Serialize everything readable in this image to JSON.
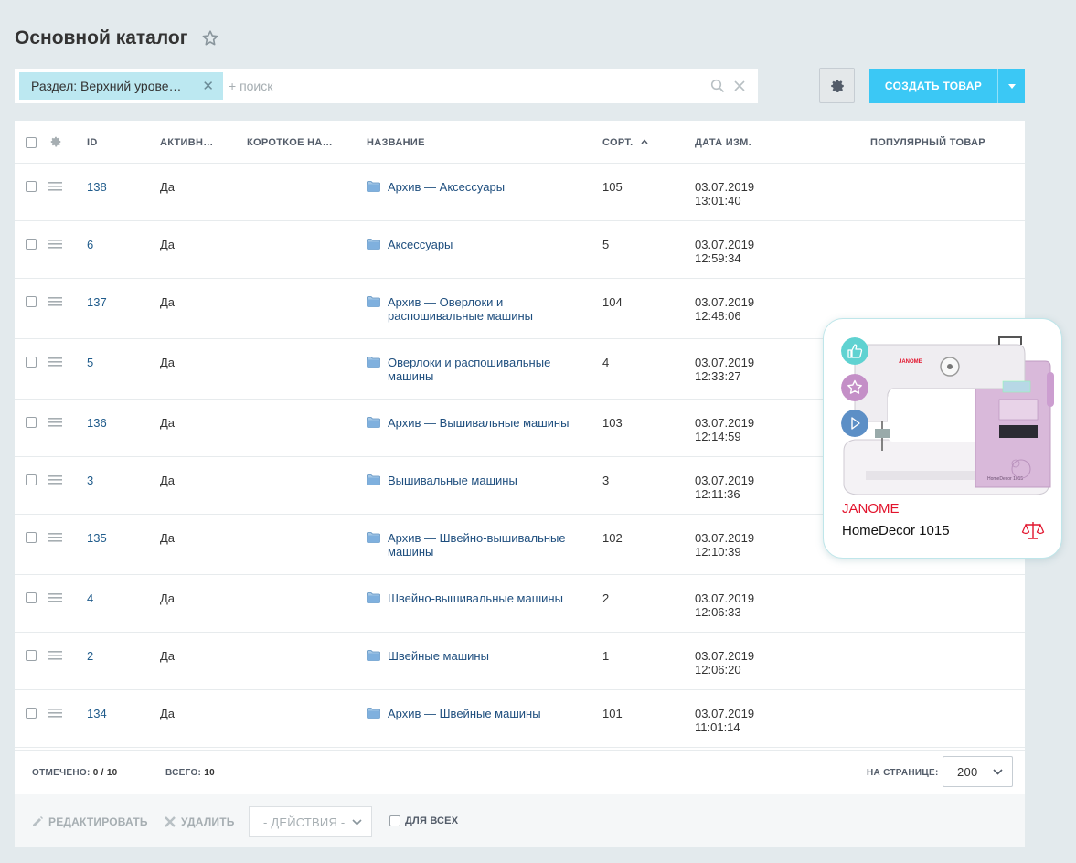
{
  "page": {
    "title": "Основной каталог"
  },
  "filter": {
    "tag_label": "Раздел: Верхний урове…",
    "search_placeholder": "+ поиск"
  },
  "toolbar": {
    "create_label": "СОЗДАТЬ ТОВАР"
  },
  "columns": {
    "id": "ID",
    "active": "АКТИВН…",
    "short_name": "КОРОТКОЕ НА…",
    "name": "НАЗВАНИЕ",
    "sort": "СОРТ.",
    "date": "ДАТА ИЗМ.",
    "popular": "ПОПУЛЯРНЫЙ ТОВАР"
  },
  "rows": [
    {
      "id": "138",
      "active": "Да",
      "name": "Архив — Аксессуары",
      "sort": "105",
      "date": "03.07.2019",
      "time": "13:01:40"
    },
    {
      "id": "6",
      "active": "Да",
      "name": "Аксессуары",
      "sort": "5",
      "date": "03.07.2019",
      "time": "12:59:34"
    },
    {
      "id": "137",
      "active": "Да",
      "name": "Архив — Оверлоки и распошивальные машины",
      "sort": "104",
      "date": "03.07.2019",
      "time": "12:48:06"
    },
    {
      "id": "5",
      "active": "Да",
      "name": "Оверлоки и распошивальные машины",
      "sort": "4",
      "date": "03.07.2019",
      "time": "12:33:27"
    },
    {
      "id": "136",
      "active": "Да",
      "name": "Архив — Вышивальные машины",
      "sort": "103",
      "date": "03.07.2019",
      "time": "12:14:59"
    },
    {
      "id": "3",
      "active": "Да",
      "name": "Вышивальные машины",
      "sort": "3",
      "date": "03.07.2019",
      "time": "12:11:36"
    },
    {
      "id": "135",
      "active": "Да",
      "name": "Архив — Швейно-вышивальные машины",
      "sort": "102",
      "date": "03.07.2019",
      "time": "12:10:39"
    },
    {
      "id": "4",
      "active": "Да",
      "name": "Швейно-вышивальные машины",
      "sort": "2",
      "date": "03.07.2019",
      "time": "12:06:33"
    },
    {
      "id": "2",
      "active": "Да",
      "name": "Швейные машины",
      "sort": "1",
      "date": "03.07.2019",
      "time": "12:06:20"
    },
    {
      "id": "134",
      "active": "Да",
      "name": "Архив — Швейные машины",
      "sort": "101",
      "date": "03.07.2019",
      "time": "11:01:14"
    }
  ],
  "footer": {
    "selected_label": "ОТМЕЧЕНО:",
    "selected_value": "0 / 10",
    "total_label": "ВСЕГО:",
    "total_value": "10",
    "per_page_label": "НА СТРАНИЦЕ:",
    "per_page_value": "200"
  },
  "actions": {
    "edit_label": "РЕДАКТИРОВАТЬ",
    "delete_label": "УДАЛИТЬ",
    "actions_select": "- ДЕЙСТВИЯ -",
    "for_all_label": "ДЛЯ ВСЕХ"
  },
  "product_card": {
    "brand": "JANOME",
    "name": "HomeDecor 1015",
    "machine_brand": "JANOME",
    "machine_model": "HomeDecor 1015"
  },
  "colors": {
    "accent": "#3bc8f5",
    "tag_bg": "#bce8f1",
    "link": "#1e4e7e",
    "brand_red": "#e2142d"
  }
}
